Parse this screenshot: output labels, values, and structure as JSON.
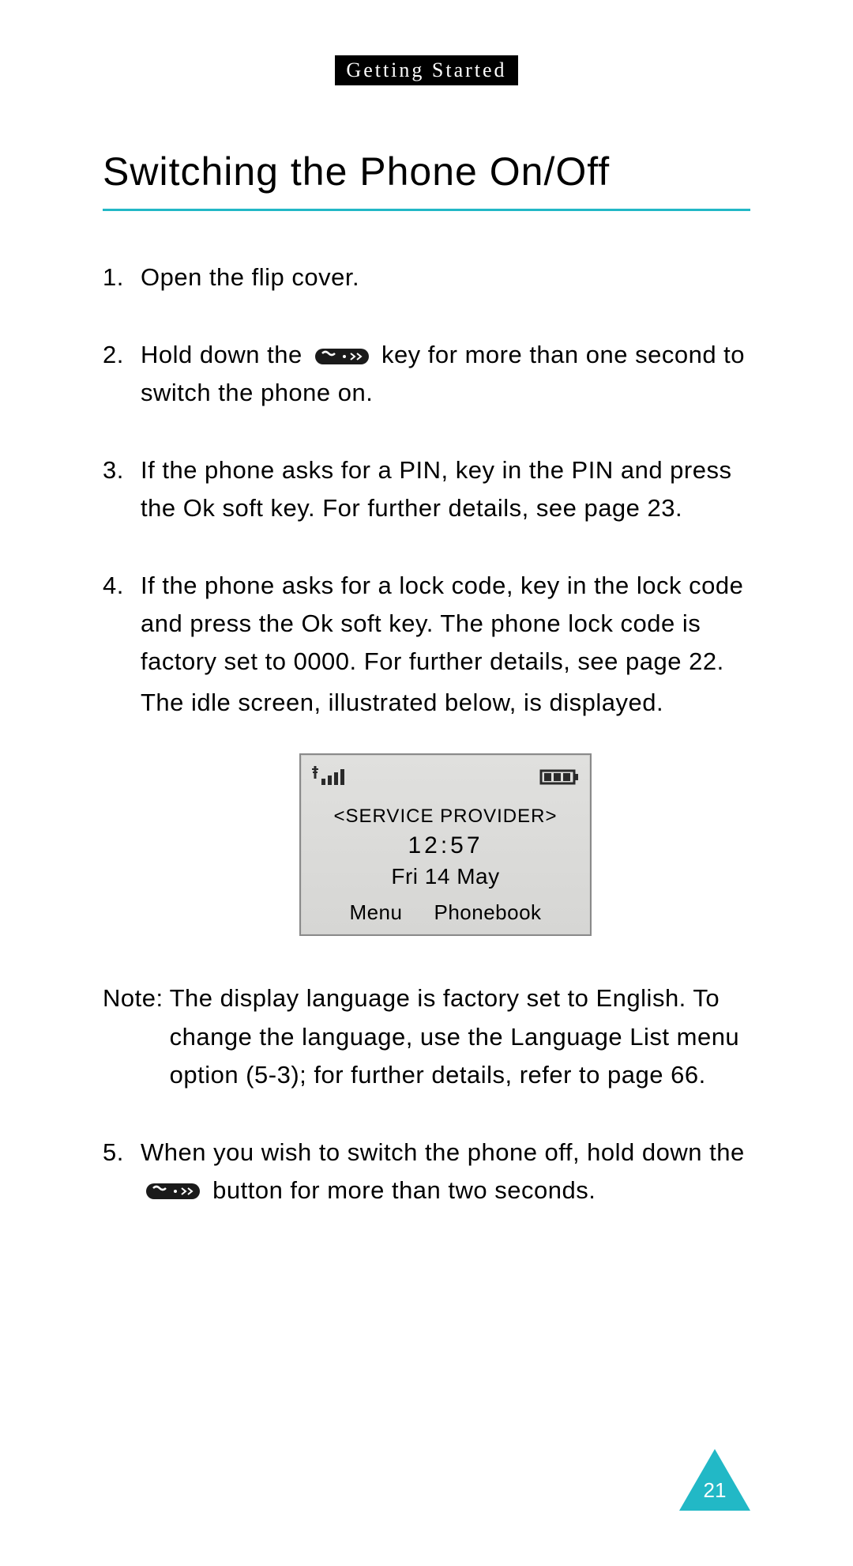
{
  "chapter": "Getting Started",
  "title": "Switching the Phone On/Off",
  "steps": {
    "s1": {
      "num": "1.",
      "text": "Open the flip cover."
    },
    "s2": {
      "num": "2.",
      "pre": "Hold down the ",
      "post": " key for more than one second to switch the phone on."
    },
    "s3": {
      "num": "3.",
      "a": "If the phone asks for a PIN, key in the PIN and press the ",
      "ok": "Ok",
      "b": " soft key. For further details, see page 23."
    },
    "s4": {
      "num": "4.",
      "a": "If the phone asks for a lock code, key in the lock code and press the ",
      "ok": "Ok",
      "b": " soft key. The phone lock code is factory set to 0000. For further details, see page 22.",
      "follow": "The idle screen, illustrated below, is displayed."
    },
    "s5": {
      "num": "5.",
      "pre": "When you wish to switch the phone off, hold down the ",
      "post": " button for more than two seconds."
    }
  },
  "phone": {
    "service_provider": "<SERVICE PROVIDER>",
    "time": "12:57",
    "date": "Fri 14 May",
    "soft_left": "Menu",
    "soft_right": "Phonebook"
  },
  "note": {
    "label": "Note:",
    "text": "The display language is factory set to English. To change the language, use the Language List menu option (5-3); for further details, refer to page 66."
  },
  "page_number": "21",
  "colors": {
    "accent": "#22b8c6"
  }
}
